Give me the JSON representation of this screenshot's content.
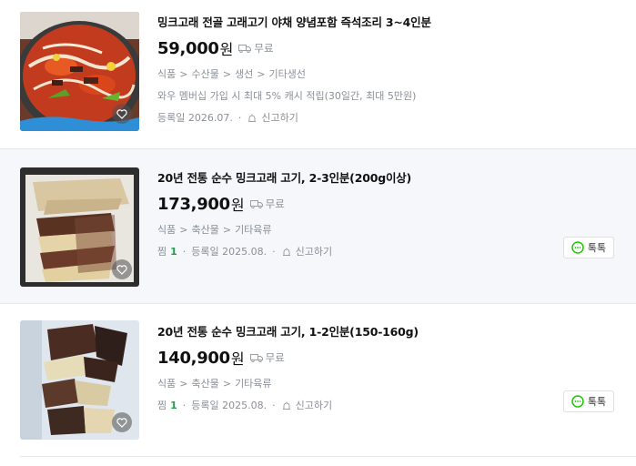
{
  "listings": [
    {
      "title": "밍크고래 전골 고래고기 야채 양념포함 즉석조리 3~4인분",
      "price": "59,000",
      "currency": "원",
      "shipping": "무료",
      "category": [
        "식품",
        "수산물",
        "생선",
        "기타생선"
      ],
      "promo": "와우 멤버십 가입 시 최대 5% 캐시 적립(30일간, 최대 5만원)",
      "date": "등록일 2026.07.",
      "report": "신고하기"
    },
    {
      "title": "20년 전통 순수 밍크고래 고기, 2-3인분(200g이상)",
      "price": "173,900",
      "currency": "원",
      "shipping": "무료",
      "category": [
        "식품",
        "축산물",
        "기타육류"
      ],
      "fav_label": "찜",
      "fav_count": "1",
      "date": "등록일 2025.08.",
      "report": "신고하기",
      "talk": "톡톡"
    },
    {
      "title": "20년 전통 순수 밍크고래 고기, 1-2인분(150-160g)",
      "price": "140,900",
      "currency": "원",
      "shipping": "무료",
      "category": [
        "식품",
        "축산물",
        "기타육류"
      ],
      "fav_label": "찜",
      "fav_count": "1",
      "date": "등록일 2025.08.",
      "report": "신고하기",
      "talk": "톡톡"
    }
  ],
  "separators": {
    "gt": ">",
    "dot": "·"
  },
  "colors": {
    "shipping_text": "#8a8f97",
    "fav_count": "#1fa04a",
    "talk_icon": "#1ec800"
  },
  "icons": [
    "heart-icon",
    "truck-icon",
    "bell-icon",
    "talk-bubble-icon"
  ]
}
